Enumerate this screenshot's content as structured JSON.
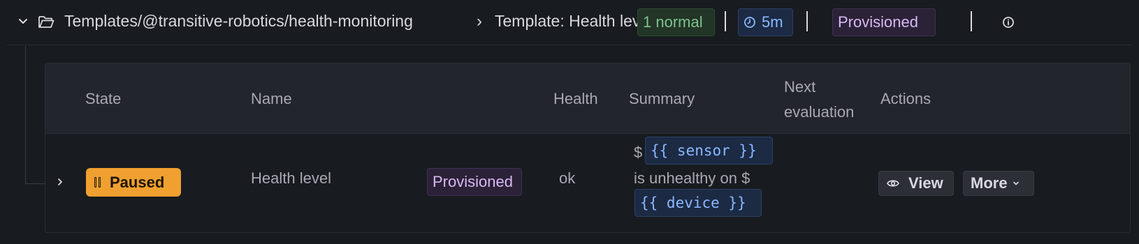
{
  "header": {
    "path": "Templates/@transitive-robotics/health-monitoring",
    "separator": "›",
    "template_title": "Template: Health level",
    "badge_normal": "1 normal",
    "badge_interval": "5m",
    "badge_provisioned": "Provisioned",
    "icons": [
      "chevron-down-icon",
      "folder-open-icon",
      "clock-icon",
      "info-icon"
    ]
  },
  "table": {
    "columns": {
      "state": "State",
      "name": "Name",
      "health": "Health",
      "summary": "Summary",
      "next_evaluation": "Next evaluation",
      "actions": "Actions"
    },
    "rows": [
      {
        "state": "Paused",
        "name": "Health level",
        "provisioned": "Provisioned",
        "health": "ok",
        "summary_prefix": "$",
        "summary_code1": "{{ sensor }}",
        "summary_mid": "is unhealthy on $",
        "summary_code2": "{{ device }}",
        "next_evaluation": "",
        "view_label": "View",
        "more_label": "More"
      }
    ]
  },
  "colors": {
    "background": "#181b1f",
    "state_paused": "#f0a030",
    "provisioned": "#d9b8f4",
    "normal": "#7fc18e",
    "code": "#8ab8ff"
  }
}
